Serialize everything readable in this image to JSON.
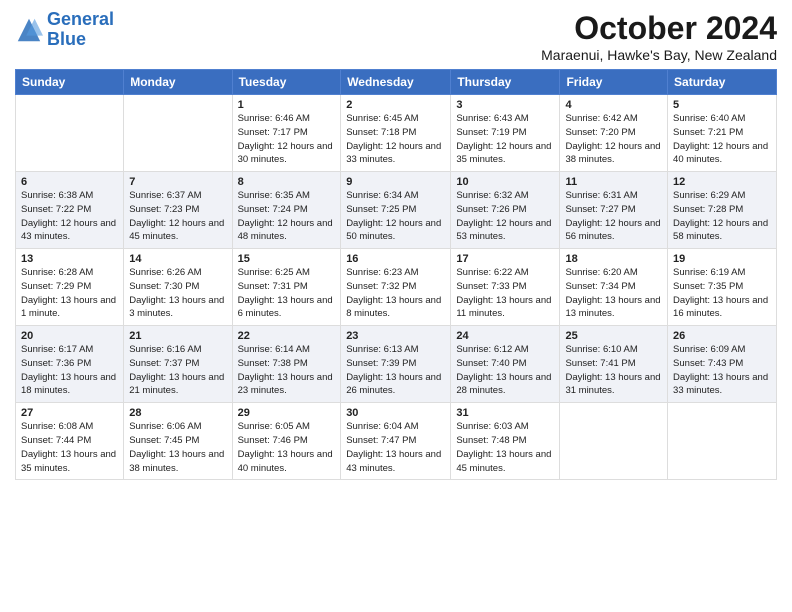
{
  "header": {
    "logo_line1": "General",
    "logo_line2": "Blue",
    "title": "October 2024",
    "subtitle": "Maraenui, Hawke's Bay, New Zealand"
  },
  "days_of_week": [
    "Sunday",
    "Monday",
    "Tuesday",
    "Wednesday",
    "Thursday",
    "Friday",
    "Saturday"
  ],
  "weeks": [
    [
      {
        "day": "",
        "sunrise": "",
        "sunset": "",
        "daylight": ""
      },
      {
        "day": "",
        "sunrise": "",
        "sunset": "",
        "daylight": ""
      },
      {
        "day": "1",
        "sunrise": "Sunrise: 6:46 AM",
        "sunset": "Sunset: 7:17 PM",
        "daylight": "Daylight: 12 hours and 30 minutes."
      },
      {
        "day": "2",
        "sunrise": "Sunrise: 6:45 AM",
        "sunset": "Sunset: 7:18 PM",
        "daylight": "Daylight: 12 hours and 33 minutes."
      },
      {
        "day": "3",
        "sunrise": "Sunrise: 6:43 AM",
        "sunset": "Sunset: 7:19 PM",
        "daylight": "Daylight: 12 hours and 35 minutes."
      },
      {
        "day": "4",
        "sunrise": "Sunrise: 6:42 AM",
        "sunset": "Sunset: 7:20 PM",
        "daylight": "Daylight: 12 hours and 38 minutes."
      },
      {
        "day": "5",
        "sunrise": "Sunrise: 6:40 AM",
        "sunset": "Sunset: 7:21 PM",
        "daylight": "Daylight: 12 hours and 40 minutes."
      }
    ],
    [
      {
        "day": "6",
        "sunrise": "Sunrise: 6:38 AM",
        "sunset": "Sunset: 7:22 PM",
        "daylight": "Daylight: 12 hours and 43 minutes."
      },
      {
        "day": "7",
        "sunrise": "Sunrise: 6:37 AM",
        "sunset": "Sunset: 7:23 PM",
        "daylight": "Daylight: 12 hours and 45 minutes."
      },
      {
        "day": "8",
        "sunrise": "Sunrise: 6:35 AM",
        "sunset": "Sunset: 7:24 PM",
        "daylight": "Daylight: 12 hours and 48 minutes."
      },
      {
        "day": "9",
        "sunrise": "Sunrise: 6:34 AM",
        "sunset": "Sunset: 7:25 PM",
        "daylight": "Daylight: 12 hours and 50 minutes."
      },
      {
        "day": "10",
        "sunrise": "Sunrise: 6:32 AM",
        "sunset": "Sunset: 7:26 PM",
        "daylight": "Daylight: 12 hours and 53 minutes."
      },
      {
        "day": "11",
        "sunrise": "Sunrise: 6:31 AM",
        "sunset": "Sunset: 7:27 PM",
        "daylight": "Daylight: 12 hours and 56 minutes."
      },
      {
        "day": "12",
        "sunrise": "Sunrise: 6:29 AM",
        "sunset": "Sunset: 7:28 PM",
        "daylight": "Daylight: 12 hours and 58 minutes."
      }
    ],
    [
      {
        "day": "13",
        "sunrise": "Sunrise: 6:28 AM",
        "sunset": "Sunset: 7:29 PM",
        "daylight": "Daylight: 13 hours and 1 minute."
      },
      {
        "day": "14",
        "sunrise": "Sunrise: 6:26 AM",
        "sunset": "Sunset: 7:30 PM",
        "daylight": "Daylight: 13 hours and 3 minutes."
      },
      {
        "day": "15",
        "sunrise": "Sunrise: 6:25 AM",
        "sunset": "Sunset: 7:31 PM",
        "daylight": "Daylight: 13 hours and 6 minutes."
      },
      {
        "day": "16",
        "sunrise": "Sunrise: 6:23 AM",
        "sunset": "Sunset: 7:32 PM",
        "daylight": "Daylight: 13 hours and 8 minutes."
      },
      {
        "day": "17",
        "sunrise": "Sunrise: 6:22 AM",
        "sunset": "Sunset: 7:33 PM",
        "daylight": "Daylight: 13 hours and 11 minutes."
      },
      {
        "day": "18",
        "sunrise": "Sunrise: 6:20 AM",
        "sunset": "Sunset: 7:34 PM",
        "daylight": "Daylight: 13 hours and 13 minutes."
      },
      {
        "day": "19",
        "sunrise": "Sunrise: 6:19 AM",
        "sunset": "Sunset: 7:35 PM",
        "daylight": "Daylight: 13 hours and 16 minutes."
      }
    ],
    [
      {
        "day": "20",
        "sunrise": "Sunrise: 6:17 AM",
        "sunset": "Sunset: 7:36 PM",
        "daylight": "Daylight: 13 hours and 18 minutes."
      },
      {
        "day": "21",
        "sunrise": "Sunrise: 6:16 AM",
        "sunset": "Sunset: 7:37 PM",
        "daylight": "Daylight: 13 hours and 21 minutes."
      },
      {
        "day": "22",
        "sunrise": "Sunrise: 6:14 AM",
        "sunset": "Sunset: 7:38 PM",
        "daylight": "Daylight: 13 hours and 23 minutes."
      },
      {
        "day": "23",
        "sunrise": "Sunrise: 6:13 AM",
        "sunset": "Sunset: 7:39 PM",
        "daylight": "Daylight: 13 hours and 26 minutes."
      },
      {
        "day": "24",
        "sunrise": "Sunrise: 6:12 AM",
        "sunset": "Sunset: 7:40 PM",
        "daylight": "Daylight: 13 hours and 28 minutes."
      },
      {
        "day": "25",
        "sunrise": "Sunrise: 6:10 AM",
        "sunset": "Sunset: 7:41 PM",
        "daylight": "Daylight: 13 hours and 31 minutes."
      },
      {
        "day": "26",
        "sunrise": "Sunrise: 6:09 AM",
        "sunset": "Sunset: 7:43 PM",
        "daylight": "Daylight: 13 hours and 33 minutes."
      }
    ],
    [
      {
        "day": "27",
        "sunrise": "Sunrise: 6:08 AM",
        "sunset": "Sunset: 7:44 PM",
        "daylight": "Daylight: 13 hours and 35 minutes."
      },
      {
        "day": "28",
        "sunrise": "Sunrise: 6:06 AM",
        "sunset": "Sunset: 7:45 PM",
        "daylight": "Daylight: 13 hours and 38 minutes."
      },
      {
        "day": "29",
        "sunrise": "Sunrise: 6:05 AM",
        "sunset": "Sunset: 7:46 PM",
        "daylight": "Daylight: 13 hours and 40 minutes."
      },
      {
        "day": "30",
        "sunrise": "Sunrise: 6:04 AM",
        "sunset": "Sunset: 7:47 PM",
        "daylight": "Daylight: 13 hours and 43 minutes."
      },
      {
        "day": "31",
        "sunrise": "Sunrise: 6:03 AM",
        "sunset": "Sunset: 7:48 PM",
        "daylight": "Daylight: 13 hours and 45 minutes."
      },
      {
        "day": "",
        "sunrise": "",
        "sunset": "",
        "daylight": ""
      },
      {
        "day": "",
        "sunrise": "",
        "sunset": "",
        "daylight": ""
      }
    ]
  ]
}
